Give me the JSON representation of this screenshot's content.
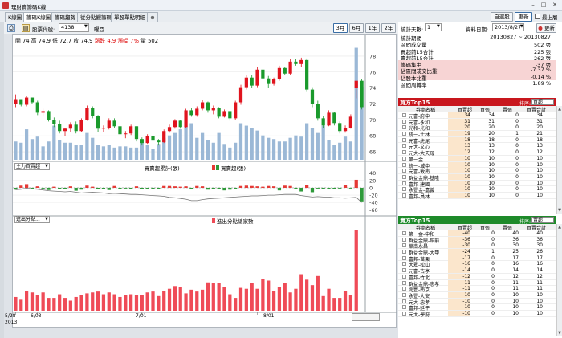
{
  "window": {
    "title": "理財寶籌碼K線",
    "minimize": "–",
    "maximize": "□",
    "close": "✕"
  },
  "tabs": [
    {
      "label": "K線圖"
    },
    {
      "label": "籌碼K線圖"
    },
    {
      "label": "籌碼趨勢"
    },
    {
      "label": "從分點觀籌碼"
    },
    {
      "label": "單股單點明細"
    }
  ],
  "top_right": {
    "custom_label": "自選股",
    "refresh_label": "更新",
    "always_on_top_label": "最上層"
  },
  "toolbar": {
    "stock_code_label": "股票代號:",
    "stock_code": "4138",
    "stock_name": "曜亞",
    "ranges": [
      "3月",
      "6月",
      "1年",
      "2年"
    ],
    "active_range": "3月"
  },
  "ohlc": {
    "open_label": "開",
    "open": "74",
    "high_label": "高",
    "high": "74.9",
    "low_label": "低",
    "low": "72.7",
    "close_label": "收",
    "close": "74.9",
    "change_label": "漲跌",
    "change": "4.9",
    "pct_label": "漲幅",
    "pct": "7%",
    "vol_label": "量",
    "vol": "502"
  },
  "price_axis": {
    "ticks": [
      "78",
      "76",
      "74",
      "72",
      "70",
      "68",
      "66"
    ]
  },
  "panel2": {
    "selector": "主力買賣超",
    "legend_line": "買賣超累計(張)",
    "legend_bar": "買賣超(張)",
    "ticks": [
      "40",
      "20",
      "0",
      "-20",
      "-40",
      "-60"
    ]
  },
  "panel3": {
    "selector": "進出分點...",
    "legend_bar": "進出分點總家數"
  },
  "x_axis": {
    "labels": [
      "5/28",
      "6/03",
      "7/01",
      "8/01"
    ],
    "year": "2013"
  },
  "right_header": {
    "stat_days_label": "統計天數:",
    "stat_days": "1",
    "date_label": "資料日期:",
    "date": "2013/8/27",
    "update_label": "更新"
  },
  "stats": [
    {
      "k": "統計期間",
      "v": "20130827 ~ 20130827",
      "hl": false
    },
    {
      "k": "區間成交量",
      "v": "502 張",
      "hl": false
    },
    {
      "k": "買超前15合計",
      "v": "225 張",
      "hl": false
    },
    {
      "k": "賣超前15合計",
      "v": "-262 張",
      "hl": false
    },
    {
      "k": "籌碼集中",
      "v": "-37 張",
      "hl": true
    },
    {
      "k": "佔區間成交比重",
      "v": "-7.37 %",
      "hl": true
    },
    {
      "k": "佔股本比重",
      "v": "-0.14 %",
      "hl": true
    },
    {
      "k": "區間周轉率",
      "v": "1.89 %",
      "hl": false
    }
  ],
  "buy_section": {
    "title": "買方Top15",
    "sort_label": "排序:",
    "sort_value": "買超",
    "color": "#c8161d"
  },
  "sell_section": {
    "title": "賣方Top15",
    "sort_label": "排序:",
    "sort_value": "賣超",
    "color": "#1e8a2a"
  },
  "grid_columns": [
    "券商名稱",
    "買賣超",
    "買張",
    "賣張",
    "買賣合計"
  ],
  "buy_rows": [
    {
      "name": "元富-府中",
      "net": "34",
      "buy": "34",
      "sell": "0",
      "total": "34"
    },
    {
      "name": "元富-永和",
      "net": "31",
      "buy": "31",
      "sell": "0",
      "total": "31"
    },
    {
      "name": "光和-光和",
      "net": "20",
      "buy": "20",
      "sell": "0",
      "total": "20"
    },
    {
      "name": "統一-士林",
      "net": "19",
      "buy": "20",
      "sell": "1",
      "total": "21"
    },
    {
      "name": "元富-虎尾",
      "net": "18",
      "buy": "18",
      "sell": "0",
      "total": "18"
    },
    {
      "name": "元大-文心",
      "net": "13",
      "buy": "13",
      "sell": "0",
      "total": "13"
    },
    {
      "name": "元大-大天母",
      "net": "12",
      "buy": "12",
      "sell": "0",
      "total": "12"
    },
    {
      "name": "第一金",
      "net": "10",
      "buy": "10",
      "sell": "0",
      "total": "10"
    },
    {
      "name": "統一-城中",
      "net": "10",
      "buy": "10",
      "sell": "0",
      "total": "10"
    },
    {
      "name": "元富-敦南",
      "net": "10",
      "buy": "10",
      "sell": "0",
      "total": "10"
    },
    {
      "name": "群益金鼎-基隆",
      "net": "10",
      "buy": "10",
      "sell": "0",
      "total": "10"
    },
    {
      "name": "富邦-建國",
      "net": "10",
      "buy": "10",
      "sell": "0",
      "total": "10"
    },
    {
      "name": "永豐金-嘉義",
      "net": "10",
      "buy": "10",
      "sell": "0",
      "total": "10"
    },
    {
      "name": "富邦-員林",
      "net": "10",
      "buy": "10",
      "sell": "0",
      "total": "10"
    }
  ],
  "sell_rows": [
    {
      "name": "第一金-中和",
      "net": "-40",
      "buy": "0",
      "sell": "40",
      "total": "40"
    },
    {
      "name": "群益金鼎-館前",
      "net": "-36",
      "buy": "0",
      "sell": "36",
      "total": "36"
    },
    {
      "name": "華南永昌",
      "net": "-30",
      "buy": "0",
      "sell": "30",
      "total": "30"
    },
    {
      "name": "群益金鼎-大甲",
      "net": "-24",
      "buy": "1",
      "sell": "25",
      "total": "26"
    },
    {
      "name": "富邦-苗栗",
      "net": "-17",
      "buy": "0",
      "sell": "17",
      "total": "17"
    },
    {
      "name": "大眾-松山",
      "net": "-16",
      "buy": "0",
      "sell": "16",
      "total": "16"
    },
    {
      "name": "元富-古亭",
      "net": "-14",
      "buy": "0",
      "sell": "14",
      "total": "14"
    },
    {
      "name": "富邦-竹北",
      "net": "-12",
      "buy": "0",
      "sell": "12",
      "total": "12"
    },
    {
      "name": "群益金鼎-忠孝",
      "net": "-11",
      "buy": "0",
      "sell": "11",
      "total": "11"
    },
    {
      "name": "兆豐-南京",
      "net": "-11",
      "buy": "0",
      "sell": "11",
      "total": "11"
    },
    {
      "name": "永豐-大安",
      "net": "-10",
      "buy": "0",
      "sell": "10",
      "total": "10"
    },
    {
      "name": "元大-忠孝",
      "net": "-10",
      "buy": "0",
      "sell": "10",
      "total": "10"
    },
    {
      "name": "富邦-延平",
      "net": "-10",
      "buy": "0",
      "sell": "10",
      "total": "10"
    },
    {
      "name": "元大-學府",
      "net": "-10",
      "buy": "0",
      "sell": "10",
      "total": "10"
    }
  ],
  "chart_data": {
    "type": "candlestick",
    "price_range": [
      65,
      79.5
    ],
    "candles": [
      [
        72,
        73.2,
        71.6,
        72.6
      ],
      [
        72.6,
        72.6,
        71.7,
        71.9
      ],
      [
        71.9,
        73,
        71.7,
        72.8
      ],
      [
        72.8,
        72.8,
        72,
        72.2
      ],
      [
        72.2,
        72.4,
        70.6,
        70.9
      ],
      [
        70.9,
        71.4,
        70.4,
        71.1
      ],
      [
        71.1,
        71.2,
        69.8,
        70
      ],
      [
        70,
        70.3,
        69.1,
        69.5
      ],
      [
        69.5,
        69.9,
        68.3,
        68.6
      ],
      [
        68.6,
        69,
        68,
        68.9
      ],
      [
        68.9,
        69.7,
        68.5,
        69.4
      ],
      [
        69.4,
        69.8,
        68.3,
        68.6
      ],
      [
        68.6,
        70.2,
        68.5,
        70
      ],
      [
        70,
        71.8,
        69.9,
        71.5
      ],
      [
        71.5,
        71.7,
        70.2,
        70.5
      ],
      [
        70.5,
        70.6,
        68.5,
        68.9
      ],
      [
        68.9,
        69.3,
        68.5,
        69
      ],
      [
        69,
        70.2,
        68.8,
        69.9
      ],
      [
        69.9,
        70.2,
        69,
        69.2
      ],
      [
        69.2,
        69.3,
        67.9,
        68.2
      ],
      [
        68.2,
        68.6,
        67.7,
        68.3
      ],
      [
        68.3,
        69.4,
        68.1,
        69.2
      ],
      [
        69.2,
        69.2,
        67.3,
        67.6
      ],
      [
        67.6,
        67.8,
        66.8,
        67.1
      ],
      [
        67.1,
        68.2,
        67,
        68
      ],
      [
        68,
        68.2,
        67.2,
        67.4
      ],
      [
        67.4,
        67.6,
        66.8,
        67.2
      ],
      [
        67.2,
        68.8,
        67.1,
        68.6
      ],
      [
        68.6,
        69.4,
        68.4,
        69.1
      ],
      [
        69.1,
        70.1,
        68.9,
        69.9
      ],
      [
        69.9,
        70,
        68.9,
        69.1
      ],
      [
        69.1,
        71.4,
        69,
        71.2
      ],
      [
        71.2,
        71.5,
        70.4,
        70.6
      ],
      [
        70.6,
        71.7,
        70.4,
        71.4
      ],
      [
        71.4,
        72.5,
        71.2,
        72.2
      ],
      [
        72.2,
        72.3,
        70.9,
        71.2
      ],
      [
        71.2,
        71.8,
        70.7,
        71.5
      ],
      [
        71.5,
        71.6,
        70.2,
        70.4
      ],
      [
        70.4,
        71.3,
        70.3,
        71.1
      ],
      [
        71.1,
        71.1,
        69.9,
        70.2
      ],
      [
        70.2,
        72.4,
        70,
        72.2
      ],
      [
        72.2,
        74.4,
        71.9,
        74.1
      ],
      [
        74.1,
        75.6,
        73.8,
        75.3
      ],
      [
        75.3,
        75.6,
        74,
        74.3
      ],
      [
        74.3,
        76.6,
        74.1,
        76.3
      ],
      [
        76.3,
        76.5,
        75,
        75.2
      ],
      [
        75.2,
        75.5,
        74,
        74.5
      ],
      [
        74.5,
        75.3,
        74.3,
        75.1
      ],
      [
        75.1,
        76.8,
        74.9,
        76.5
      ],
      [
        76.5,
        76.6,
        75.6,
        75.8
      ],
      [
        75.8,
        77.6,
        75.6,
        77.3
      ],
      [
        77.3,
        77.6,
        76.8,
        77
      ],
      [
        77,
        77.8,
        76.6,
        77.5
      ],
      [
        77.5,
        77.7,
        73.6,
        73.8
      ],
      [
        73.8,
        74.1,
        71.6,
        72
      ],
      [
        72,
        72.4,
        69.9,
        70.2
      ],
      [
        70.2,
        70.5,
        69,
        69.3
      ],
      [
        69.3,
        71.2,
        69.2,
        70.9
      ],
      [
        70.9,
        71,
        69.3,
        69.6
      ],
      [
        69.6,
        69.8,
        68.3,
        68.6
      ],
      [
        68.6,
        69.3,
        68.4,
        69
      ],
      [
        69,
        70.7,
        68.9,
        70.4
      ],
      [
        74,
        74.9,
        72.7,
        74.9
      ],
      [
        74.9,
        75.1,
        71.3,
        71.6
      ]
    ],
    "volume": [
      15,
      14,
      25,
      17,
      19,
      11,
      15,
      28,
      16,
      14,
      14,
      12,
      12,
      22,
      18,
      12,
      11,
      12,
      10,
      11,
      11,
      10,
      10,
      14,
      12,
      9,
      13,
      18,
      20,
      22,
      25,
      28,
      30,
      18,
      22,
      16,
      14,
      22,
      13,
      10,
      14,
      30,
      28,
      26,
      24,
      20,
      18,
      17,
      15,
      15,
      18,
      20,
      19,
      30,
      26,
      22,
      28,
      16,
      12,
      14,
      19,
      15,
      92,
      60
    ],
    "volume_range": [
      0,
      95
    ],
    "net": [
      -5,
      6,
      10,
      -3,
      4,
      -2,
      -6,
      3,
      -4,
      -3,
      4,
      -8,
      -5,
      6,
      3,
      -4,
      -3,
      -6,
      5,
      -3,
      -2,
      -3,
      4,
      -4,
      -3,
      -4,
      -3,
      5,
      5,
      4,
      3,
      4,
      -3,
      5,
      4,
      -5,
      -4,
      -3,
      -7,
      -5,
      -3,
      5,
      6,
      5,
      4,
      3,
      5,
      4,
      -7,
      6,
      5,
      -3,
      -10,
      8,
      -12,
      -2,
      -4,
      -3,
      -4,
      -2,
      7,
      -2,
      22,
      -37
    ],
    "cumulative": [
      -5,
      -4,
      -1,
      -3,
      -4,
      -6,
      -8,
      -9,
      -10,
      -11,
      -10,
      -12,
      -14,
      -13,
      -12,
      -13,
      -14,
      -16,
      -15,
      -16,
      -17,
      -18,
      -18,
      -19,
      -20,
      -21,
      -22,
      -23,
      -26,
      -27,
      -29,
      -31,
      -35,
      -35,
      -32,
      -30,
      -29,
      -28,
      -27,
      -26,
      -25,
      -24,
      -23,
      -22,
      -22,
      -21,
      -20,
      -20,
      -19,
      -18,
      -18,
      -18,
      -21,
      -23,
      -25,
      -24,
      -25,
      -25,
      -27,
      -27,
      -28,
      -27,
      -26,
      -40
    ],
    "net_range": [
      -68,
      46
    ],
    "branches": [
      15,
      12,
      22,
      20,
      17,
      20,
      14,
      14,
      18,
      14,
      11,
      15,
      17,
      19,
      20,
      21,
      18,
      20,
      18,
      15,
      17,
      18,
      17,
      17,
      20,
      21,
      16,
      22,
      24,
      27,
      26,
      19,
      23,
      21,
      23,
      31,
      30,
      30,
      26,
      18,
      14,
      25,
      24,
      30,
      24,
      35,
      33,
      22,
      26,
      30,
      20,
      24,
      40,
      34,
      28,
      38,
      16,
      24,
      14,
      14,
      22,
      17,
      88,
      0
    ],
    "branch_range": [
      0,
      95
    ],
    "x_tick_labels": [
      "5/28",
      "6/03",
      "7/01",
      "8/01"
    ],
    "x_tick_index": [
      0,
      4,
      23,
      44
    ]
  }
}
